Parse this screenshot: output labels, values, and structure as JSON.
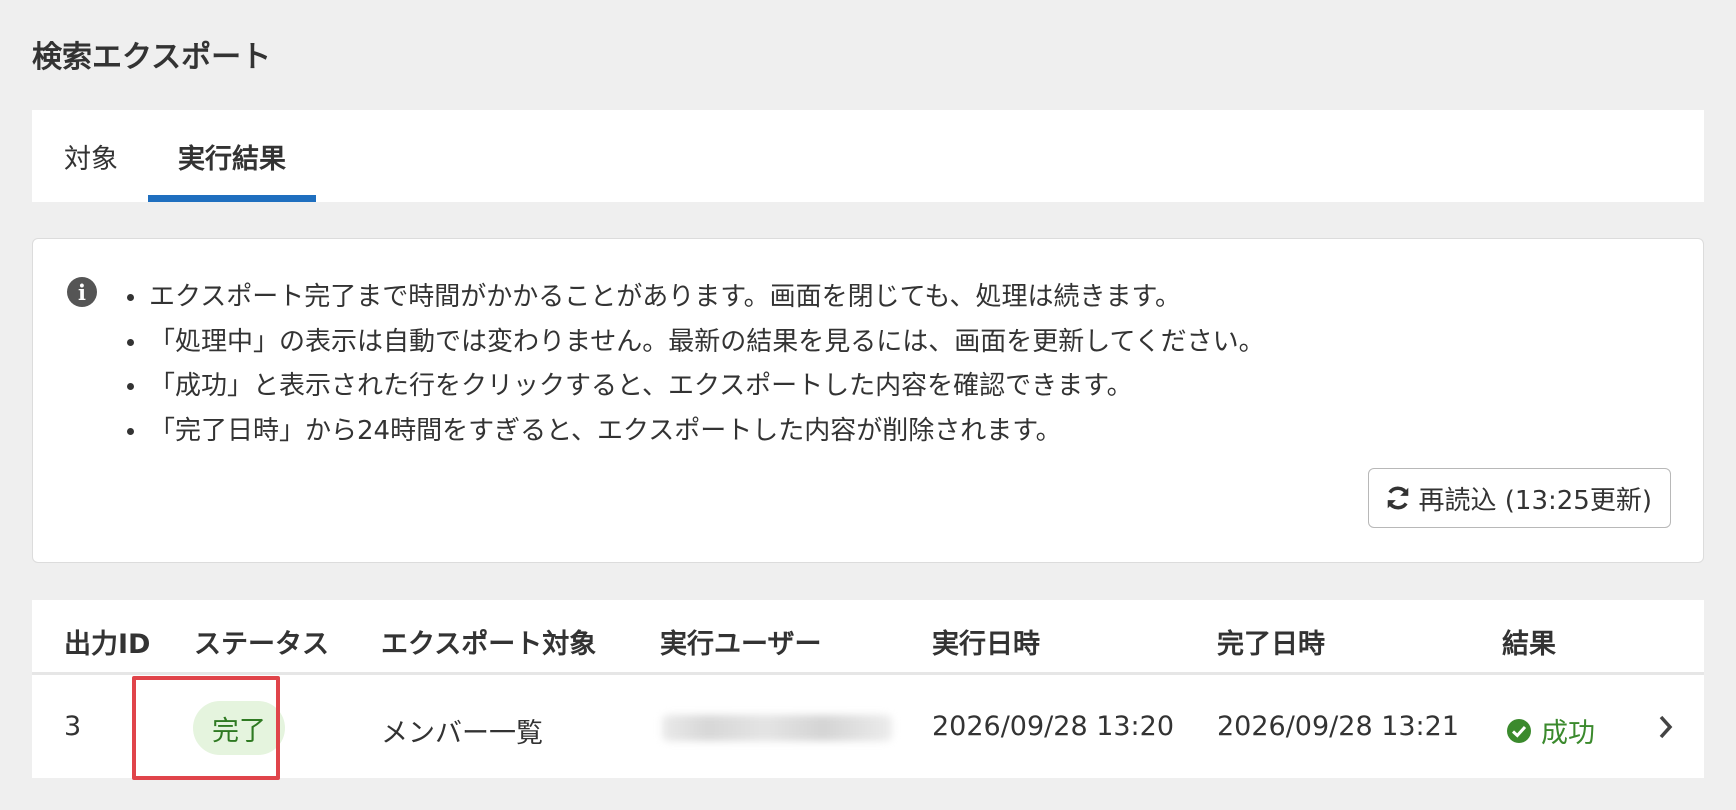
{
  "page": {
    "title": "検索エクスポート"
  },
  "tabs": [
    {
      "label": "対象",
      "active": false
    },
    {
      "label": "実行結果",
      "active": true
    }
  ],
  "notice": {
    "icon": "info-icon",
    "items": [
      "エクスポート完了まで時間がかかることがあります。画面を閉じても、処理は続きます。",
      "「処理中」の表示は自動では変わりません。最新の結果を見るには、画面を更新してください。",
      "「成功」と表示された行をクリックすると、エクスポートした内容を確認できます。",
      "「完了日時」から24時間をすぎると、エクスポートした内容が削除されます。"
    ],
    "reload_button": {
      "icon": "refresh-icon",
      "label": "再読込 (13:25更新)"
    }
  },
  "table": {
    "columns": [
      "出力ID",
      "ステータス",
      "エクスポート対象",
      "実行ユーザー",
      "実行日時",
      "完了日時",
      "結果"
    ],
    "rows": [
      {
        "id": "3",
        "status": "完了",
        "target": "メンバー一覧",
        "user": "",
        "executed_at": "2026/09/28 13:20",
        "completed_at": "2026/09/28 13:21",
        "result": "成功",
        "result_icon": "check-circle-icon",
        "row_icon": "chevron-right-icon"
      }
    ]
  },
  "colors": {
    "tab_active_underline": "#1f6fbf",
    "success_green": "#3b8a2d",
    "status_badge_bg": "#e5f4de",
    "highlight_red": "#e0444a"
  }
}
